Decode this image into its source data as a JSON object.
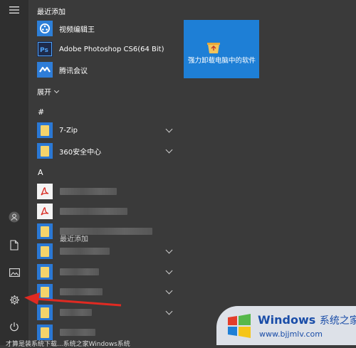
{
  "rail": {
    "menu_icon": "hamburger-icon",
    "user_icon": "user-icon",
    "docs_icon": "document-icon",
    "pictures_icon": "pictures-icon",
    "settings_icon": "gear-icon",
    "power_icon": "power-icon"
  },
  "recent": {
    "heading": "最近添加",
    "items": [
      {
        "label": "视频编辑王",
        "icon": "video-editor-icon"
      },
      {
        "label": "Adobe Photoshop CS6(64 Bit)",
        "icon": "photoshop-icon"
      },
      {
        "label": "腾讯会议",
        "icon": "tencent-meeting-icon"
      }
    ],
    "expand_label": "展开"
  },
  "groups": {
    "hash": "#",
    "a": "A"
  },
  "apps": [
    {
      "label": "7-Zip",
      "icon": "folder-icon"
    },
    {
      "label": "360安全中心",
      "icon": "folder-icon"
    }
  ],
  "tile": {
    "label": "强力卸载电脑中的软件",
    "icon": "recycle-box-icon"
  },
  "ghost_text": "最近添加",
  "watermark": {
    "brand": "Windows",
    "brand_suffix": "系统之家",
    "url": "www.bjjmlv.com"
  },
  "caption": "才算是装系统下载...系统之家Windows系统"
}
